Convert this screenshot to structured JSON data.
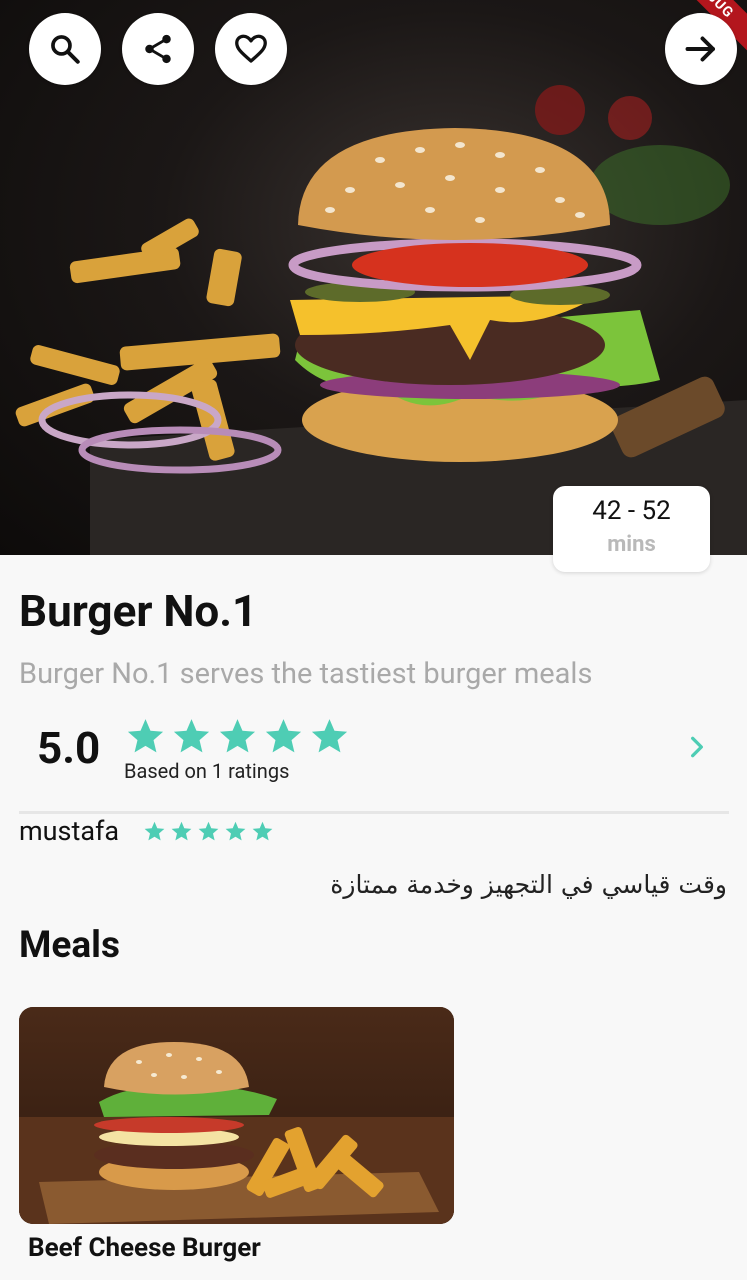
{
  "header": {
    "actions": [
      {
        "icon": "search-icon"
      },
      {
        "icon": "share-icon"
      },
      {
        "icon": "heart-icon"
      }
    ],
    "next_icon": "arrow-right-icon",
    "debug_label": "BUG"
  },
  "restaurant": {
    "name": "Burger No.1",
    "description": "Burger No.1 serves the tastiest burger meals",
    "prep_time": {
      "range": "42 - 52",
      "unit": "mins"
    }
  },
  "rating": {
    "value": "5.0",
    "stars": 5,
    "caption": "Based on 1 ratings"
  },
  "review": {
    "author": "mustafa",
    "stars": 5,
    "text": "وقت قياسي في التجهيز وخدمة ممتازة"
  },
  "meals": {
    "title": "Meals",
    "items": [
      {
        "name": "Beef Cheese Burger"
      }
    ]
  },
  "colors": {
    "accent": "#4ecdb4",
    "debug": "#b3161d"
  }
}
